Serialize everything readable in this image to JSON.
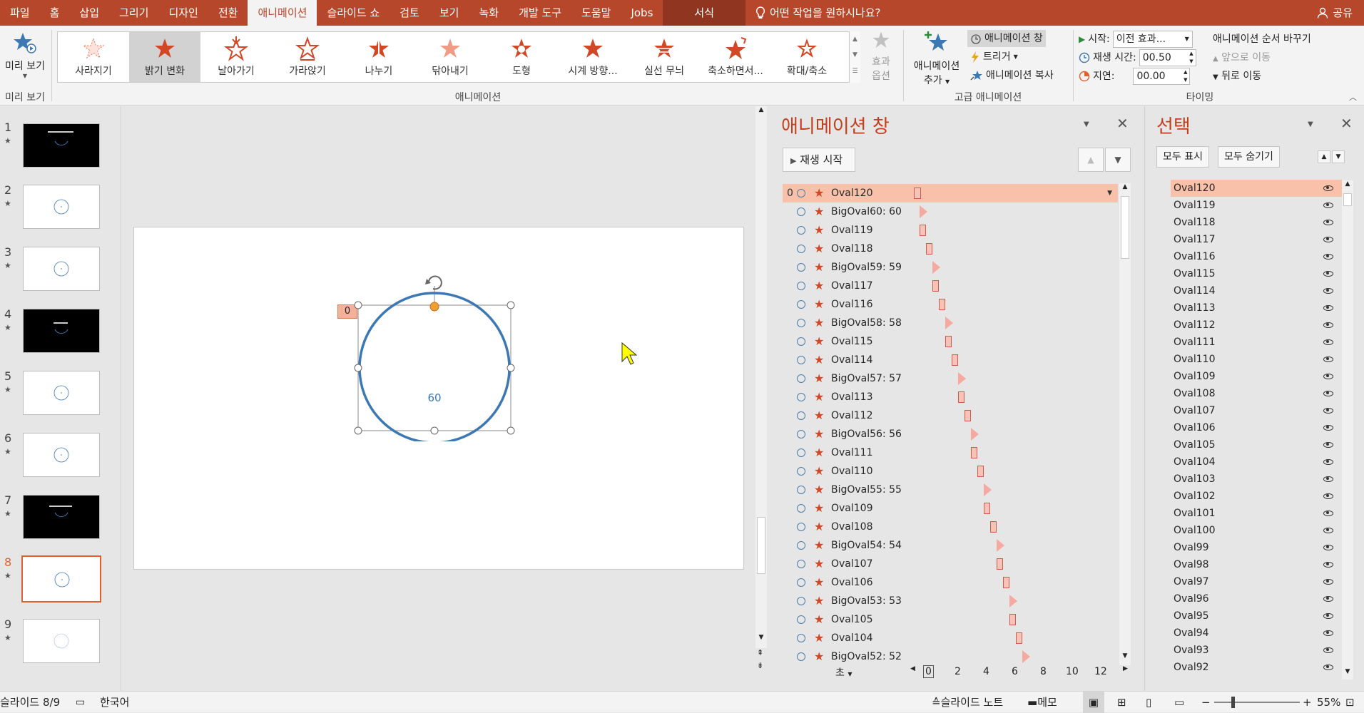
{
  "tabs": [
    "파일",
    "홈",
    "삽입",
    "그리기",
    "디자인",
    "전환",
    "애니메이션",
    "슬라이드 쇼",
    "검토",
    "보기",
    "녹화",
    "개발 도구",
    "도움말",
    "Jobs",
    "서식"
  ],
  "active_tab": "애니메이션",
  "tell_me": "어떤 작업을 원하시나요?",
  "share": "공유",
  "ribbon": {
    "preview": {
      "label": "미리 보기",
      "group": "미리 보기"
    },
    "animation_group": "애니메이션",
    "gallery": [
      "사라지기",
      "밝기 변화",
      "날아가기",
      "가라앉기",
      "나누기",
      "닦아내기",
      "도형",
      "시계 방향...",
      "실선 무늬",
      "축소하면서...",
      "확대/축소"
    ],
    "effect_options": [
      "효과",
      "옵션"
    ],
    "advanced": {
      "add_animation": [
        "애니메이션",
        "추가"
      ],
      "pane": "애니메이션 창",
      "trigger": "트리거",
      "painter": "애니메이션 복사",
      "group": "고급 애니메이션"
    },
    "timing": {
      "start_label": "시작:",
      "start_value": "이전 효과...",
      "duration_label": "재생 시간:",
      "duration_value": "00.50",
      "delay_label": "지연:",
      "delay_value": "00.00",
      "reorder": "애니메이션 순서 바꾸기",
      "move_earlier": "앞으로 이동",
      "move_later": "뒤로 이동",
      "group": "타이밍"
    }
  },
  "slides": [
    "1",
    "2",
    "3",
    "4",
    "5",
    "6",
    "7",
    "8",
    "9"
  ],
  "current_slide": 8,
  "canvas": {
    "shape_text": "60",
    "anim_tag": "0"
  },
  "anim_pane": {
    "title": "애니메이션 창",
    "play": "재생 시작",
    "first_index": "0",
    "items": [
      "Oval120",
      "BigOval60: 60",
      "Oval119",
      "Oval118",
      "BigOval59: 59",
      "Oval117",
      "Oval116",
      "BigOval58: 58",
      "Oval115",
      "Oval114",
      "BigOval57: 57",
      "Oval113",
      "Oval112",
      "BigOval56: 56",
      "Oval111",
      "Oval110",
      "BigOval55: 55",
      "Oval109",
      "Oval108",
      "BigOval54: 54",
      "Oval107",
      "Oval106",
      "BigOval53: 53",
      "Oval105",
      "Oval104",
      "BigOval52: 52"
    ],
    "seconds_label": "초",
    "timeline_ticks": [
      "0",
      "2",
      "4",
      "6",
      "8",
      "10",
      "12"
    ]
  },
  "sel_pane": {
    "title": "선택",
    "show_all": "모두 표시",
    "hide_all": "모두 숨기기",
    "items": [
      "Oval120",
      "Oval119",
      "Oval118",
      "Oval117",
      "Oval116",
      "Oval115",
      "Oval114",
      "Oval113",
      "Oval112",
      "Oval111",
      "Oval110",
      "Oval109",
      "Oval108",
      "Oval107",
      "Oval106",
      "Oval105",
      "Oval104",
      "Oval103",
      "Oval102",
      "Oval101",
      "Oval100",
      "Oval99",
      "Oval98",
      "Oval97",
      "Oval96",
      "Oval95",
      "Oval94",
      "Oval93",
      "Oval92"
    ]
  },
  "status": {
    "slide": "슬라이드 8/9",
    "language": "한국어",
    "notes": "슬라이드 노트",
    "comments": "메모",
    "zoom": "55%"
  },
  "colors": {
    "accent": "#b7472a",
    "star": "#d24726",
    "selection": "#f9c1a9",
    "shape": "#3c78b4"
  }
}
